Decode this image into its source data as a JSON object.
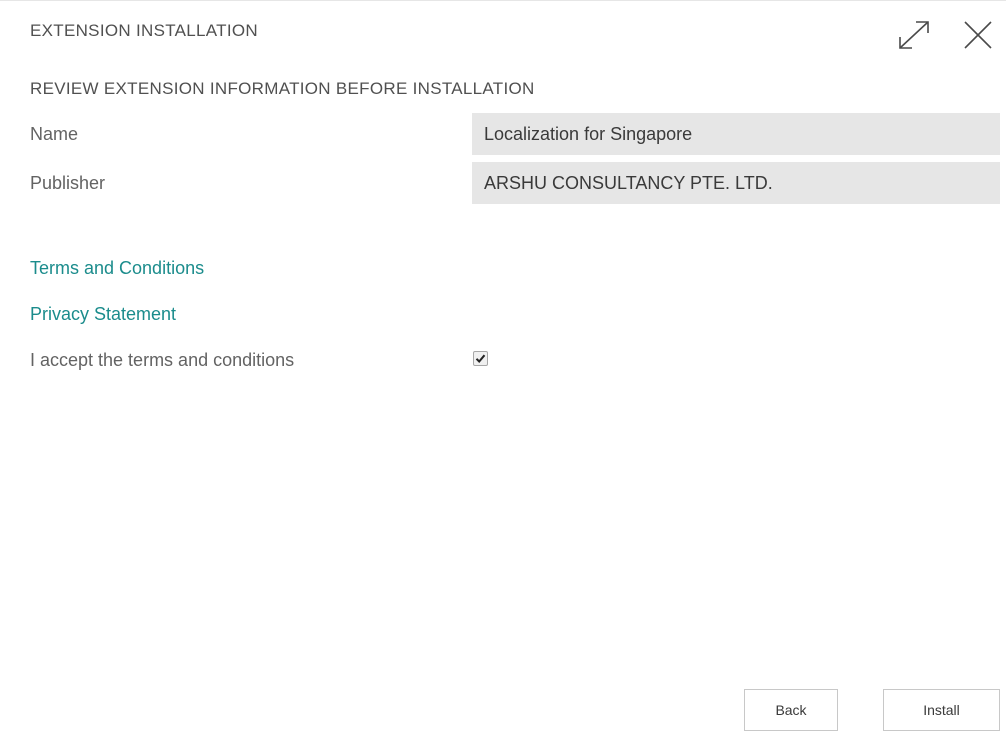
{
  "dialog": {
    "title": "EXTENSION INSTALLATION",
    "expand_icon": "expand-icon",
    "close_icon": "close-icon"
  },
  "section": {
    "heading": "REVIEW EXTENSION INFORMATION BEFORE INSTALLATION"
  },
  "fields": [
    {
      "label": "Name",
      "value": "Localization for Singapore"
    },
    {
      "label": "Publisher",
      "value": "ARSHU CONSULTANCY PTE. LTD."
    }
  ],
  "links": {
    "terms": "Terms and Conditions",
    "privacy": "Privacy Statement"
  },
  "accept": {
    "label": "I accept the terms and conditions",
    "checked": true
  },
  "buttons": {
    "back": "Back",
    "install": "Install"
  },
  "colors": {
    "link": "#1b8c8c",
    "field_background": "#e6e6e6",
    "heading_text": "#505050"
  }
}
